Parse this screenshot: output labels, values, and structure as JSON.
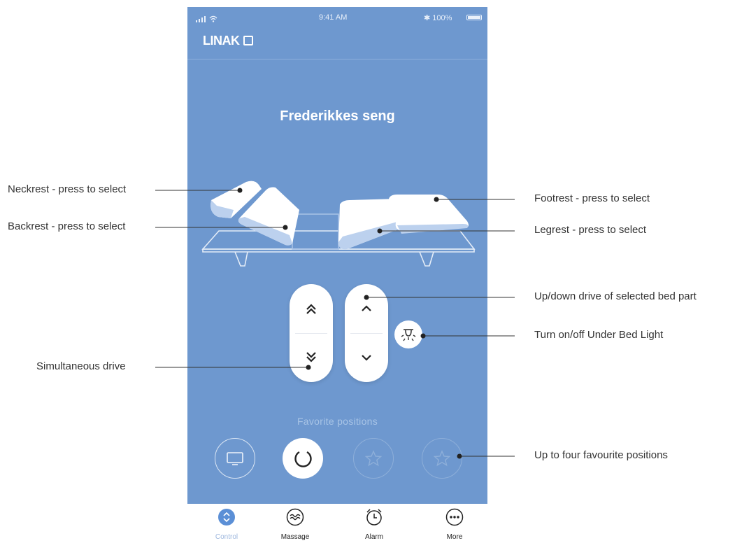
{
  "status_bar": {
    "time": "9:41 AM",
    "battery": "✱ 100%"
  },
  "header": {
    "logo_text": "LINAK"
  },
  "bed": {
    "name": "Frederikkes seng"
  },
  "favorites": {
    "label": "Favorite positions",
    "items": [
      {
        "icon": "tv-icon",
        "state": "default"
      },
      {
        "icon": "circle-arrow-icon",
        "state": "active"
      },
      {
        "icon": "star-icon",
        "state": "empty"
      },
      {
        "icon": "star-icon",
        "state": "empty"
      }
    ]
  },
  "tabs": [
    {
      "label": "Control",
      "icon": "chevron-updown-icon",
      "active": true
    },
    {
      "label": "Massage",
      "icon": "massage-wave-icon",
      "active": false
    },
    {
      "label": "Alarm",
      "icon": "alarm-clock-icon",
      "active": false
    },
    {
      "label": "More",
      "icon": "ellipsis-icon",
      "active": false
    }
  ],
  "annotations": {
    "neckrest": "Neckrest - press to select",
    "backrest": "Backrest - press to select",
    "footrest": "Footrest - press to select",
    "legrest": "Legrest - press to select",
    "updown": "Up/down drive of selected bed part",
    "light": "Turn on/off Under Bed Light",
    "simultaneous": "Simultaneous drive",
    "favourites": "Up to four favourite positions"
  },
  "colors": {
    "screen_bg": "#6e98cf",
    "accent": "#5b8fd6",
    "white": "#ffffff"
  }
}
